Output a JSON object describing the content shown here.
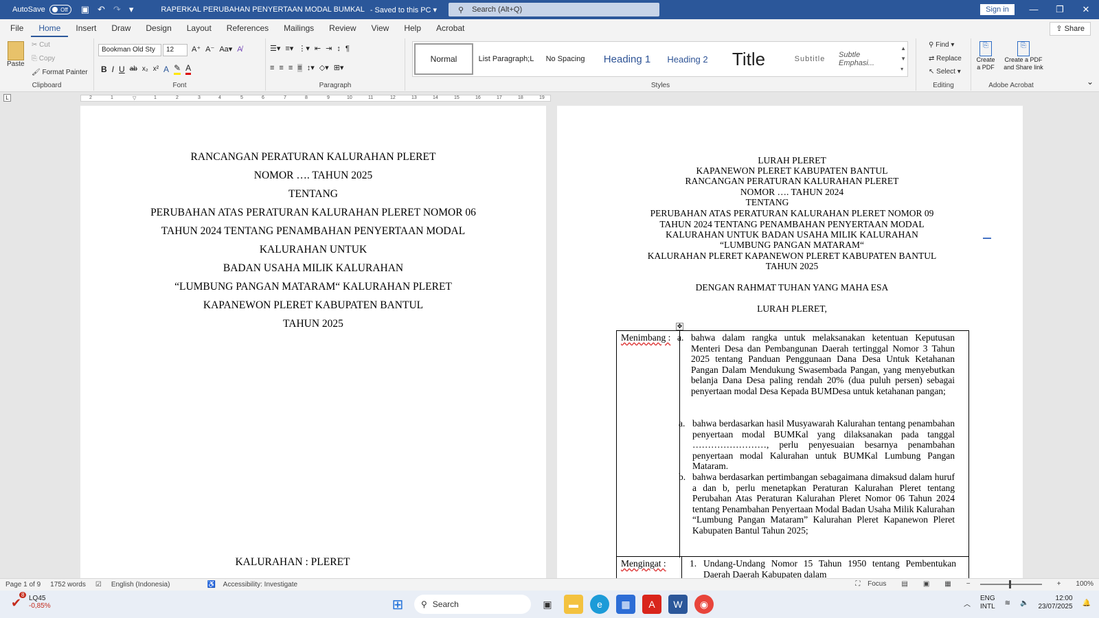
{
  "titlebar": {
    "autosave_label": "AutoSave",
    "autosave_state": "Off",
    "doc_title": "RAPERKAL PERUBAHAN PENYERTAAN MODAL BUMKAL",
    "save_status": "Saved to this PC",
    "search_placeholder": "Search (Alt+Q)",
    "signin": "Sign in"
  },
  "tabs": [
    "File",
    "Home",
    "Insert",
    "Draw",
    "Design",
    "Layout",
    "References",
    "Mailings",
    "Review",
    "View",
    "Help",
    "Acrobat"
  ],
  "share": "Share",
  "ribbon": {
    "clipboard": {
      "paste": "Paste",
      "cut": "Cut",
      "copy": "Copy",
      "format_painter": "Format Painter",
      "label": "Clipboard"
    },
    "font": {
      "name": "Bookman Old Sty",
      "size": "12",
      "label": "Font"
    },
    "paragraph": {
      "label": "Paragraph"
    },
    "styles": {
      "label": "Styles",
      "items": [
        "Normal",
        "List Paragraph;L",
        "No Spacing",
        "Heading 1",
        "Heading 2",
        "Title",
        "Subtitle",
        "Subtle Emphasi..."
      ]
    },
    "editing": {
      "find": "Find",
      "replace": "Replace",
      "select": "Select",
      "label": "Editing"
    },
    "acrobat": {
      "create_pdf": "Create a PDF",
      "create_share": "Create a PDF and Share link",
      "label": "Adobe Acrobat"
    }
  },
  "page1": {
    "lines": [
      "RANCANGAN PERATURAN KALURAHAN PLERET",
      "NOMOR …. TAHUN 2025",
      "TENTANG",
      "PERUBAHAN ATAS PERATURAN KALURAHAN PLERET NOMOR 06",
      "TAHUN 2024 TENTANG PENAMBAHAN PENYERTAAN MODAL",
      "KALURAHAN UNTUK",
      "BADAN USAHA MILIK KALURAHAN",
      "“LUMBUNG PANGAN MATARAM“ KALURAHAN PLERET",
      "KAPANEWON PLERET KABUPATEN BANTUL",
      "TAHUN 2025"
    ],
    "footer_line": "KALURAHAN    : PLERET"
  },
  "page2": {
    "header_lines": [
      "LURAH PLERET",
      "KAPANEWON PLERET KABUPATEN BANTUL",
      "RANCANGAN PERATURAN KALURAHAN PLERET",
      "NOMOR …. TAHUN 2024",
      "TENTANG",
      "PERUBAHAN ATAS PERATURAN KALURAHAN PLERET NOMOR 09",
      "TAHUN 2024 TENTANG PENAMBAHAN PENYERTAAN MODAL",
      "KALURAHAN UNTUK BADAN USAHA MILIK KALURAHAN",
      "“LUMBUNG PANGAN MATARAM“",
      "KALURAHAN PLERET KAPANEWON PLERET KABUPATEN BANTUL",
      "TAHUN 2025"
    ],
    "rahmat": "DENGAN RAHMAT TUHAN YANG MAHA ESA",
    "lurah": "LURAH PLERET,",
    "menimbang_label": "Menimbang :",
    "clauses": [
      {
        "label": "a.",
        "text": "bahwa dalam rangka untuk melaksanakan ketentuan Keputusan Menteri Desa dan Pembangunan Daerah tertinggal Nomor 3 Tahun 2025 tentang Panduan Penggunaan Dana Desa Untuk Ketahanan Pangan Dalam Mendukung Swasembada Pangan, yang menyebutkan belanja Dana Desa paling rendah 20% (dua puluh persen) sebagai penyertaan modal Desa Kepada BUMDesa untuk ketahanan pangan;"
      },
      {
        "label": "a.",
        "text": "bahwa berdasarkan hasil Musyawarah Kalurahan tentang penambahan penyertaan modal BUMKal yang dilaksanakan pada tanggal ……………………, perlu penyesuaian besarnya penambahan penyertaan modal Kalurahan untuk BUMKal Lumbung Pangan Mataram."
      },
      {
        "label": "b.",
        "text": "bahwa berdasarkan pertimbangan sebagaimana dimaksud dalam huruf a dan b, perlu menetapkan Peraturan Kalurahan Pleret tentang Perubahan Atas Peraturan Kalurahan Pleret Nomor 06 Tahun 2024 tentang Penambahan Penyertaan Modal Badan Usaha Milik Kalurahan “Lumbung Pangan Mataram” Kalurahan Pleret Kapanewon Pleret Kabupaten Bantul Tahun 2025;"
      }
    ],
    "mengingat_label": "Mengingat :",
    "mengingat_item": {
      "label": "1.",
      "text": "Undang-Undang Nomor 15 Tahun 1950 tentang Pembentukan Daerah Daerah Kabupaten dalam"
    }
  },
  "statusbar": {
    "page": "Page 1 of 9",
    "words": "1752 words",
    "language": "English (Indonesia)",
    "accessibility": "Accessibility: Investigate",
    "focus": "Focus",
    "zoom": "100%"
  },
  "taskbar": {
    "weather_name": "LQ45",
    "weather_value": "-0,85%",
    "badge": "8",
    "search": "Search",
    "lang1": "ENG",
    "lang2": "INTL",
    "time": "12:00",
    "date": "23/07/2025"
  },
  "colors": {
    "word_blue": "#2b579a",
    "spell_red": "#d33"
  }
}
